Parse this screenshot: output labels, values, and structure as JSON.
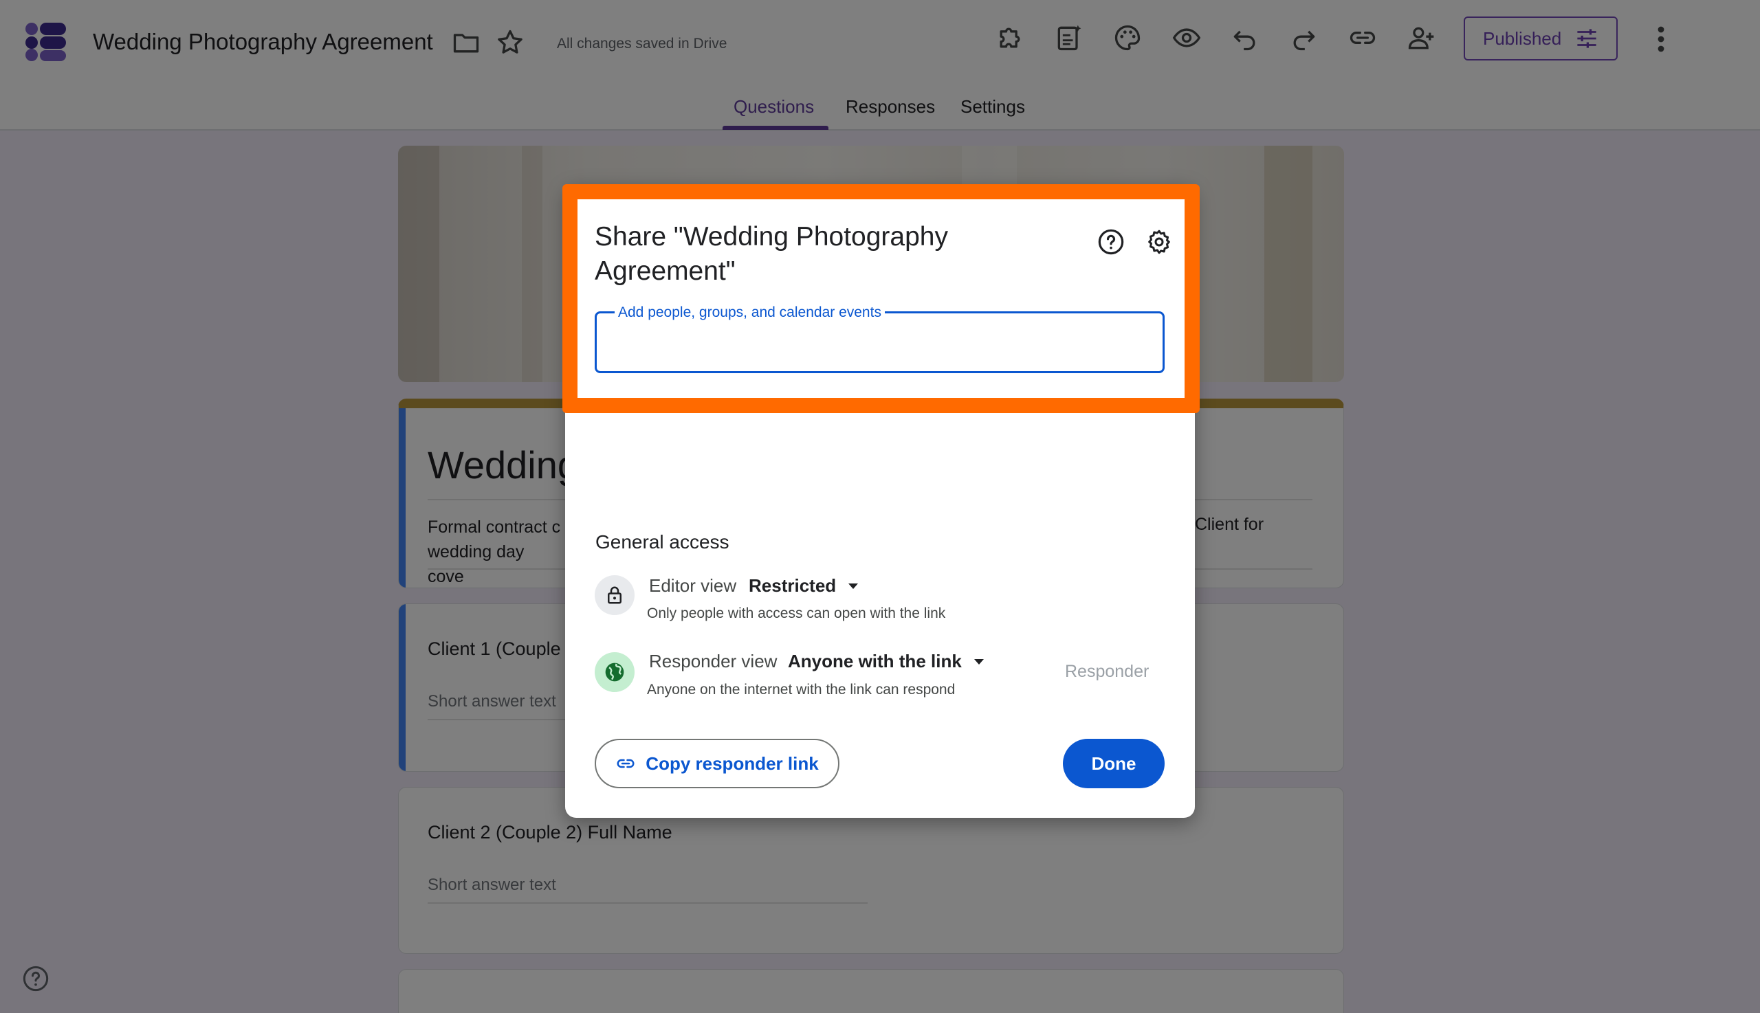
{
  "app": {
    "doc_title": "Wedding Photography Agreement",
    "saved_status": "All changes saved in Drive",
    "published_label": "Published"
  },
  "tabs": [
    {
      "label": "Questions",
      "active": true
    },
    {
      "label": "Responses",
      "active": false
    },
    {
      "label": "Settings",
      "active": false
    }
  ],
  "form": {
    "title": "Wedding",
    "description_left": "Formal contract c wedding day cove",
    "description_right": "Client for",
    "questions": [
      {
        "label": "Client 1 (Couple",
        "answer_placeholder": "Short answer text"
      },
      {
        "label": "Client 2 (Couple 2) Full Name",
        "answer_placeholder": "Short answer text"
      }
    ]
  },
  "dialog": {
    "title": "Share \"Wedding Photography Agreement\"",
    "input_label": "Add people, groups, and calendar events",
    "input_value": "",
    "general_access_heading": "General access",
    "editor": {
      "type": "Editor view",
      "value": "Restricted",
      "description": "Only people with access can open with the link"
    },
    "responder": {
      "type": "Responder view",
      "value": "Anyone with the link",
      "description": "Anyone on the internet with the link can respond",
      "role": "Responder"
    },
    "copy_link_label": "Copy responder link",
    "done_label": "Done"
  },
  "colors": {
    "accent_blue": "#0b57d0",
    "highlight_orange": "#ff6a00",
    "publish_purple": "#6b3fb0"
  },
  "icons": [
    "forms-logo-icon",
    "folder-icon",
    "star-icon",
    "addon-icon",
    "ai-form-icon",
    "palette-icon",
    "preview-icon",
    "undo-icon",
    "redo-icon",
    "link-icon",
    "add-collaborator-icon",
    "customize-icon",
    "more-vert-icon",
    "help-icon",
    "settings-gear-icon",
    "lock-icon",
    "globe-icon"
  ]
}
